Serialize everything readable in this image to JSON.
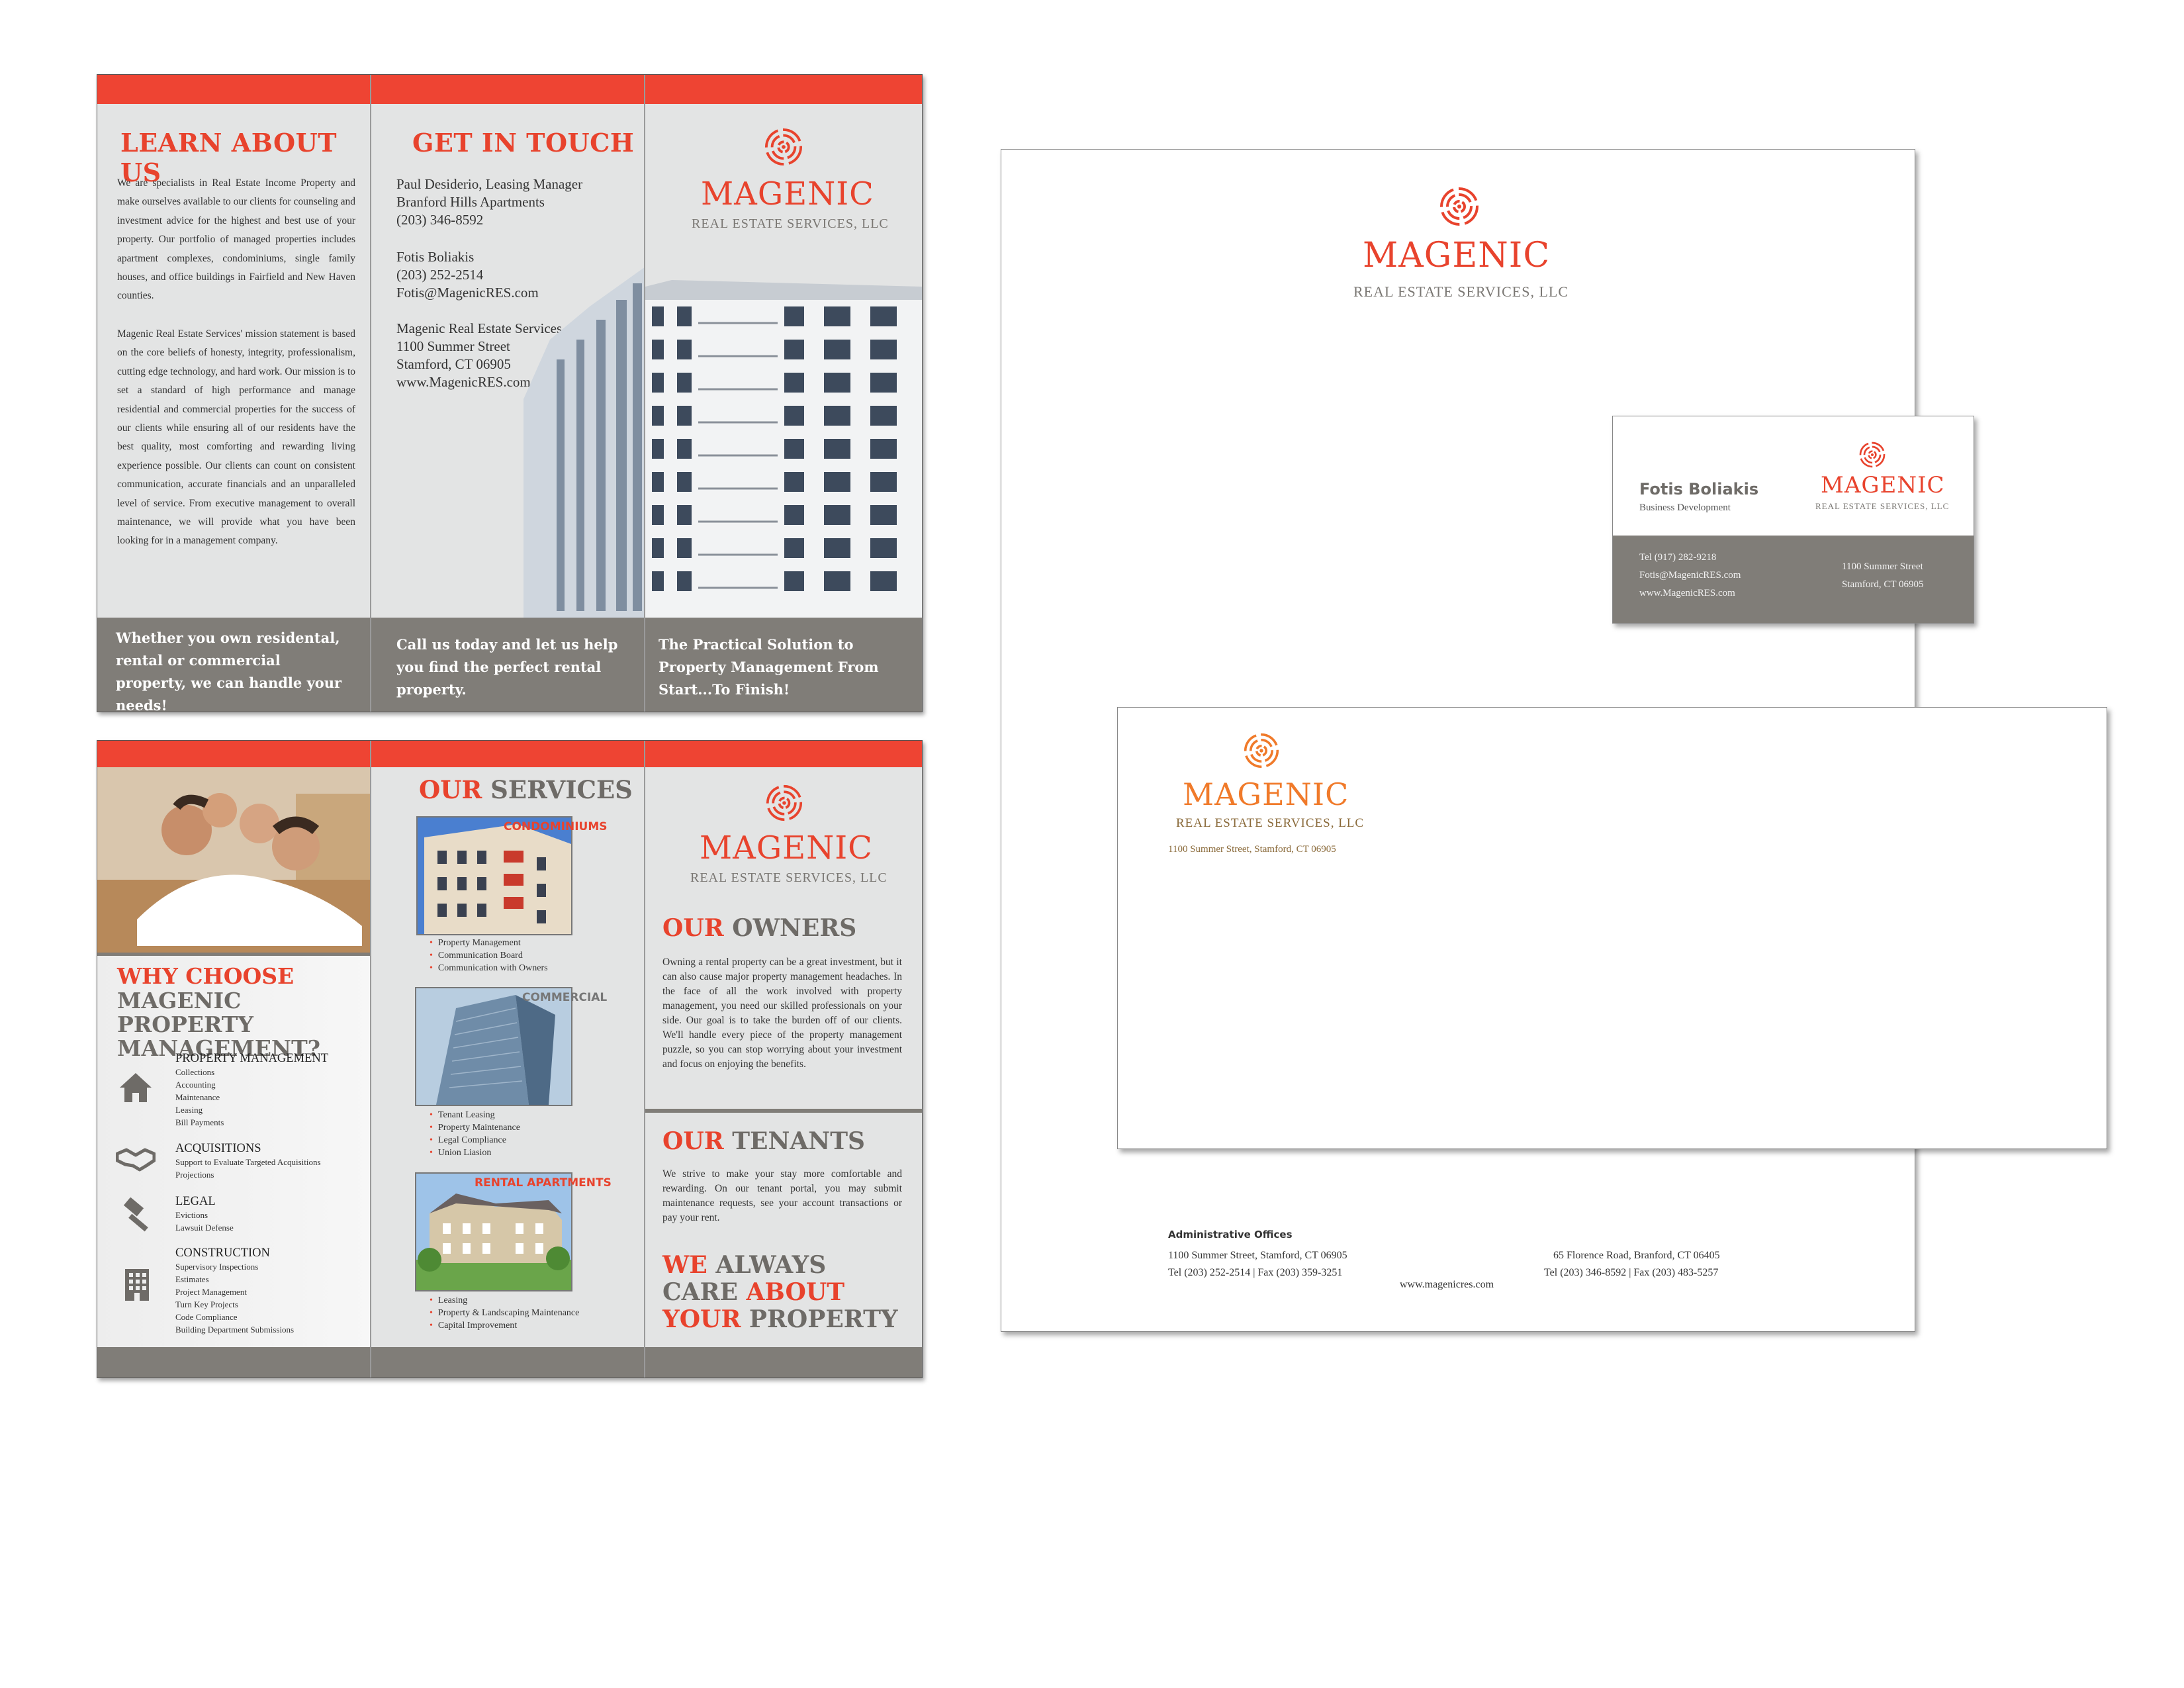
{
  "brand": {
    "name": "MAGENIC",
    "tagline": "REAL ESTATE SERVICES, LLC",
    "red": "#ee4433",
    "orange": "#f07a2a",
    "grey": "#807d78"
  },
  "brochure_outside": {
    "learn": {
      "heading": "LEARN ABOUT US",
      "para1": "We are specialists in Real Estate Income Property and make ourselves available to our clients for counseling and investment advice for the highest and best use of your property. Our portfolio of managed properties includes apartment complexes, condominiums, single family houses, and office buildings in Fairfield and New Haven counties.",
      "para2": "Magenic Real Estate Services' mission statement is based on the core beliefs of honesty, integrity, professionalism, cutting edge technology, and hard work. Our mission is to set a standard of high performance and manage residential and commercial properties for the success of our clients while ensuring all of our residents have the best quality, most comforting and rewarding living experience possible. Our clients can count on consistent communication, accurate financials and an unparalleled level of service. From executive management to overall maintenance, we will provide what you have been looking for in a management company.",
      "footer": "Whether you own residental, rental or commercial property, we can handle your needs!"
    },
    "touch": {
      "heading": "GET IN TOUCH",
      "contact1": [
        "Paul Desiderio, Leasing Manager",
        "Branford Hills Apartments",
        "(203) 346-8592"
      ],
      "contact2": [
        "Fotis Boliakis",
        "(203) 252-2514",
        "Fotis@MagenicRES.com"
      ],
      "contact3": [
        "Magenic Real Estate Services, LLC",
        "1100 Summer Street",
        "Stamford, CT 06905",
        "www.MagenicRES.com"
      ],
      "footer": "Call us today and let us help you find the perfect rental property."
    },
    "cover": {
      "footer": "The Practical Solution to Property Management From Start...To Finish!"
    }
  },
  "brochure_inside": {
    "why": {
      "heading_red": "WHY CHOOSE",
      "heading_grey": "MAGENIC PROPERTY MANAGEMENT?",
      "sections": [
        {
          "icon": "house-icon",
          "title": "PROPERTY MANAGEMENT",
          "items": [
            "Collections",
            "Accounting",
            "Maintenance",
            "Leasing",
            "Bill Payments"
          ]
        },
        {
          "icon": "handshake-icon",
          "title": "ACQUISITIONS",
          "items": [
            "Support to Evaluate Targeted Acquisitions",
            "Projections"
          ]
        },
        {
          "icon": "gavel-icon",
          "title": "LEGAL",
          "items": [
            "Evictions",
            "Lawsuit Defense"
          ]
        },
        {
          "icon": "building-icon",
          "title": "CONSTRUCTION",
          "items": [
            "Supervisory Inspections",
            "Estimates",
            "Project Management",
            "Turn Key Projects",
            "Code Compliance",
            "Building Department Submissions"
          ]
        }
      ]
    },
    "services": {
      "heading_red": "OUR",
      "heading_grey": "SERVICES",
      "blocks": [
        {
          "label": "CONDOMINIUMS",
          "items": [
            "Property Management",
            "Communication Board",
            "Communication with Owners"
          ]
        },
        {
          "label": "COMMERCIAL",
          "items": [
            "Tenant Leasing",
            "Property Maintenance",
            "Legal Compliance",
            "Union Liasion"
          ]
        },
        {
          "label": "RENTAL APARTMENTS",
          "items": [
            "Leasing",
            "Property & Landscaping Maintenance",
            "Capital Improvement"
          ]
        }
      ]
    },
    "owners": {
      "heading_red": "OUR",
      "heading_grey": "OWNERS",
      "text": "Owning a rental property can be a great investment, but it can also cause major property management headaches. In the face of all the work involved with property management, you need our skilled professionals on your side. Our goal is to take the burden off of our clients. We'll handle every piece of the property management puzzle, so you can stop worrying about your investment and focus on enjoying the benefits."
    },
    "tenants": {
      "heading_red": "OUR",
      "heading_grey": "TENANTS",
      "text": "We strive to make your stay more comfortable and rewarding. On our tenant portal, you may submit maintenance requests, see your account transactions or pay your rent."
    },
    "slogan": {
      "w1": "WE",
      "w2": "ALWAYS",
      "w3": "CARE",
      "w4": "ABOUT",
      "w5": "YOUR",
      "w6": "PROPERTY"
    }
  },
  "business_card": {
    "name": "Fotis Boliakis",
    "title": "Business Development",
    "tel": "Tel  (917) 282-9218",
    "email": "Fotis@MagenicRES.com",
    "web": "www.MagenicRES.com",
    "addr1": "1100 Summer Street",
    "addr2": "Stamford, CT 06905"
  },
  "envelope": {
    "address": "1100 Summer Street, Stamford, CT 06905"
  },
  "letterhead": {
    "offices_label": "Administrative Offices",
    "left_addr": "1100 Summer Street, Stamford, CT 06905",
    "left_tel": "Tel  (203) 252-2514  |  Fax (203) 359-3251",
    "right_addr": "65 Florence Road, Branford, CT 06405",
    "right_tel": "Tel (203) 346-8592  |  Fax (203) 483-5257",
    "web": "www.magenicres.com"
  }
}
